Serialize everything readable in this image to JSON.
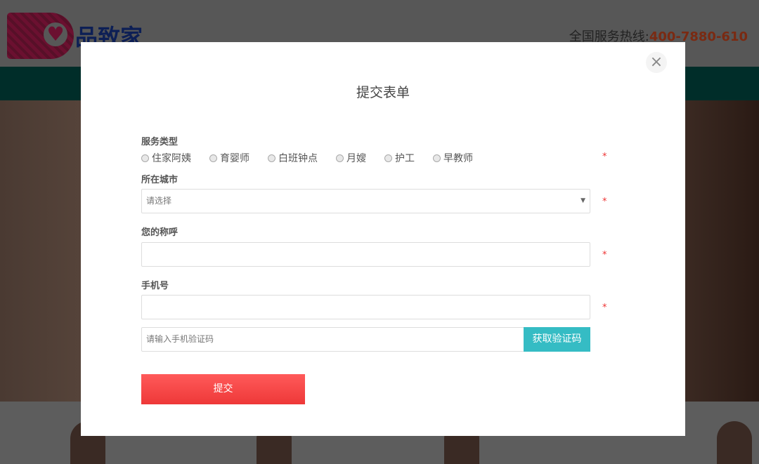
{
  "header": {
    "brand": "品致家",
    "hotline_label": "全国服务热线:",
    "hotline_number": "400-7880-610"
  },
  "modal": {
    "close_icon": "×",
    "title": "提交表单",
    "service_type": {
      "label": "服务类型",
      "options": [
        "住家阿姨",
        "育婴师",
        "白班钟点",
        "月嫂",
        "护工",
        "早教师"
      ]
    },
    "city": {
      "label": "所在城市",
      "placeholder": "请选择"
    },
    "name": {
      "label": "您的称呼",
      "value": ""
    },
    "phone": {
      "label": "手机号",
      "value": ""
    },
    "code": {
      "placeholder": "请输入手机验证码",
      "button": "获取验证码"
    },
    "required_mark": "*",
    "submit": "提交"
  }
}
